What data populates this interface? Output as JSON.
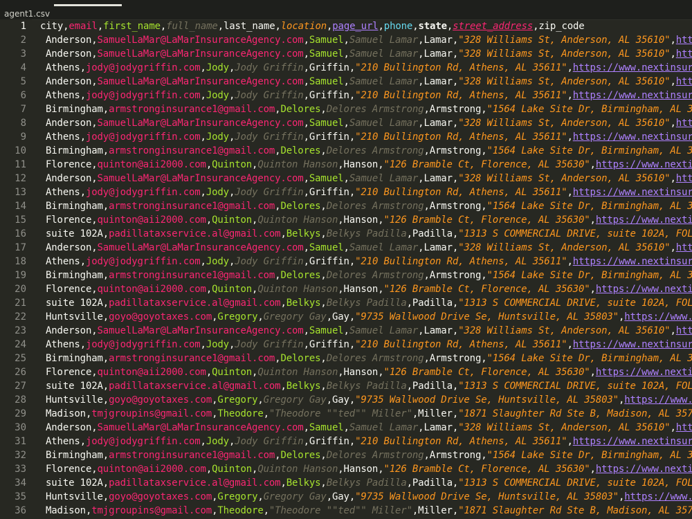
{
  "tab": {
    "title": "agent1.csv"
  },
  "header_line": {
    "number": "1",
    "fields": [
      "city",
      "email",
      "first_name",
      "full_name",
      "last_name",
      "location",
      "page_url",
      "phone",
      "state",
      "street_address",
      "zip_code"
    ],
    "sep": ","
  },
  "rows": [
    {
      "n": "2",
      "city": "Anderson",
      "email": "SamuelLaMar@LaMarInsuranceAgency.com",
      "first": "Samuel",
      "full": "Samuel Lamar",
      "last": "Lamar",
      "loc": "\"328 Williams St, Anderson, AL 35610\"",
      "url": "http"
    },
    {
      "n": "3",
      "city": "Anderson",
      "email": "SamuelLaMar@LaMarInsuranceAgency.com",
      "first": "Samuel",
      "full": "Samuel Lamar",
      "last": "Lamar",
      "loc": "\"328 Williams St, Anderson, AL 35610\"",
      "url": "http"
    },
    {
      "n": "4",
      "city": "Athens",
      "email": "jody@jodygriffin.com",
      "first": "Jody",
      "full": "Jody Griffin",
      "last": "Griffin",
      "loc": "\"210 Bullington Rd, Athens, AL 35611\"",
      "url": "https://www.nextinsur"
    },
    {
      "n": "5",
      "city": "Anderson",
      "email": "SamuelLaMar@LaMarInsuranceAgency.com",
      "first": "Samuel",
      "full": "Samuel Lamar",
      "last": "Lamar",
      "loc": "\"328 Williams St, Anderson, AL 35610\"",
      "url": "http"
    },
    {
      "n": "6",
      "city": "Athens",
      "email": "jody@jodygriffin.com",
      "first": "Jody",
      "full": "Jody Griffin",
      "last": "Griffin",
      "loc": "\"210 Bullington Rd, Athens, AL 35611\"",
      "url": "https://www.nextinsur"
    },
    {
      "n": "7",
      "city": "Birmingham",
      "email": "armstronginsurance1@gmail.com",
      "first": "Delores",
      "full": "Delores Armstrong",
      "last": "Armstrong",
      "loc": "\"1564 Lake Site Dr, Birmingham, AL 35",
      "url": ""
    },
    {
      "n": "8",
      "city": "Anderson",
      "email": "SamuelLaMar@LaMarInsuranceAgency.com",
      "first": "Samuel",
      "full": "Samuel Lamar",
      "last": "Lamar",
      "loc": "\"328 Williams St, Anderson, AL 35610\"",
      "url": "http"
    },
    {
      "n": "9",
      "city": "Athens",
      "email": "jody@jodygriffin.com",
      "first": "Jody",
      "full": "Jody Griffin",
      "last": "Griffin",
      "loc": "\"210 Bullington Rd, Athens, AL 35611\"",
      "url": "https://www.nextinsur"
    },
    {
      "n": "10",
      "city": "Birmingham",
      "email": "armstronginsurance1@gmail.com",
      "first": "Delores",
      "full": "Delores Armstrong",
      "last": "Armstrong",
      "loc": "\"1564 Lake Site Dr, Birmingham, AL 35",
      "url": ""
    },
    {
      "n": "11",
      "city": "Florence",
      "email": "quinton@aii2000.com",
      "first": "Quinton",
      "full": "Quinton Hanson",
      "last": "Hanson",
      "loc": "\"126 Bramble Ct, Florence, AL 35630\"",
      "url": "https://www.nexti"
    },
    {
      "n": "12",
      "city": "Anderson",
      "email": "SamuelLaMar@LaMarInsuranceAgency.com",
      "first": "Samuel",
      "full": "Samuel Lamar",
      "last": "Lamar",
      "loc": "\"328 Williams St, Anderson, AL 35610\"",
      "url": "http"
    },
    {
      "n": "13",
      "city": "Athens",
      "email": "jody@jodygriffin.com",
      "first": "Jody",
      "full": "Jody Griffin",
      "last": "Griffin",
      "loc": "\"210 Bullington Rd, Athens, AL 35611\"",
      "url": "https://www.nextinsur"
    },
    {
      "n": "14",
      "city": "Birmingham",
      "email": "armstronginsurance1@gmail.com",
      "first": "Delores",
      "full": "Delores Armstrong",
      "last": "Armstrong",
      "loc": "\"1564 Lake Site Dr, Birmingham, AL 35",
      "url": ""
    },
    {
      "n": "15",
      "city": "Florence",
      "email": "quinton@aii2000.com",
      "first": "Quinton",
      "full": "Quinton Hanson",
      "last": "Hanson",
      "loc": "\"126 Bramble Ct, Florence, AL 35630\"",
      "url": "https://www.nexti"
    },
    {
      "n": "16",
      "city": "suite 102A",
      "email": "padillataxservice.al@gmail.com",
      "first": "Belkys",
      "full": "Belkys Padilla",
      "last": "Padilla",
      "loc": "\"1313 S COMMERCIAL DRIVE, suite 102A, FOL",
      "url": ""
    },
    {
      "n": "17",
      "city": "Anderson",
      "email": "SamuelLaMar@LaMarInsuranceAgency.com",
      "first": "Samuel",
      "full": "Samuel Lamar",
      "last": "Lamar",
      "loc": "\"328 Williams St, Anderson, AL 35610\"",
      "url": "http"
    },
    {
      "n": "18",
      "city": "Athens",
      "email": "jody@jodygriffin.com",
      "first": "Jody",
      "full": "Jody Griffin",
      "last": "Griffin",
      "loc": "\"210 Bullington Rd, Athens, AL 35611\"",
      "url": "https://www.nextinsur"
    },
    {
      "n": "19",
      "city": "Birmingham",
      "email": "armstronginsurance1@gmail.com",
      "first": "Delores",
      "full": "Delores Armstrong",
      "last": "Armstrong",
      "loc": "\"1564 Lake Site Dr, Birmingham, AL 35",
      "url": ""
    },
    {
      "n": "20",
      "city": "Florence",
      "email": "quinton@aii2000.com",
      "first": "Quinton",
      "full": "Quinton Hanson",
      "last": "Hanson",
      "loc": "\"126 Bramble Ct, Florence, AL 35630\"",
      "url": "https://www.nexti"
    },
    {
      "n": "21",
      "city": "suite 102A",
      "email": "padillataxservice.al@gmail.com",
      "first": "Belkys",
      "full": "Belkys Padilla",
      "last": "Padilla",
      "loc": "\"1313 S COMMERCIAL DRIVE, suite 102A, FOL",
      "url": ""
    },
    {
      "n": "22",
      "city": "Huntsville",
      "email": "goyo@goyotaxes.com",
      "first": "Gregory",
      "full": "Gregory Gay",
      "last": "Gay",
      "loc": "\"9735 Wallwood Drive Se, Huntsville, AL 35803\"",
      "url": "https://www.g"
    },
    {
      "n": "23",
      "city": "Anderson",
      "email": "SamuelLaMar@LaMarInsuranceAgency.com",
      "first": "Samuel",
      "full": "Samuel Lamar",
      "last": "Lamar",
      "loc": "\"328 Williams St, Anderson, AL 35610\"",
      "url": "http"
    },
    {
      "n": "24",
      "city": "Athens",
      "email": "jody@jodygriffin.com",
      "first": "Jody",
      "full": "Jody Griffin",
      "last": "Griffin",
      "loc": "\"210 Bullington Rd, Athens, AL 35611\"",
      "url": "https://www.nextinsur"
    },
    {
      "n": "25",
      "city": "Birmingham",
      "email": "armstronginsurance1@gmail.com",
      "first": "Delores",
      "full": "Delores Armstrong",
      "last": "Armstrong",
      "loc": "\"1564 Lake Site Dr, Birmingham, AL 35",
      "url": ""
    },
    {
      "n": "26",
      "city": "Florence",
      "email": "quinton@aii2000.com",
      "first": "Quinton",
      "full": "Quinton Hanson",
      "last": "Hanson",
      "loc": "\"126 Bramble Ct, Florence, AL 35630\"",
      "url": "https://www.nexti"
    },
    {
      "n": "27",
      "city": "suite 102A",
      "email": "padillataxservice.al@gmail.com",
      "first": "Belkys",
      "full": "Belkys Padilla",
      "last": "Padilla",
      "loc": "\"1313 S COMMERCIAL DRIVE, suite 102A, FOL",
      "url": ""
    },
    {
      "n": "28",
      "city": "Huntsville",
      "email": "goyo@goyotaxes.com",
      "first": "Gregory",
      "full": "Gregory Gay",
      "last": "Gay",
      "loc": "\"9735 Wallwood Drive Se, Huntsville, AL 35803\"",
      "url": "https://www.g"
    },
    {
      "n": "29",
      "city": "Madison",
      "email": "tmjgroupins@gmail.com",
      "first": "Theodore",
      "full": "\"Theodore \"\"ted\"\" Miller\"",
      "last": "Miller",
      "loc": "\"1871 Slaughter Rd Ste B, Madison, AL 357",
      "url": ""
    },
    {
      "n": "30",
      "city": "Anderson",
      "email": "SamuelLaMar@LaMarInsuranceAgency.com",
      "first": "Samuel",
      "full": "Samuel Lamar",
      "last": "Lamar",
      "loc": "\"328 Williams St, Anderson, AL 35610\"",
      "url": "http"
    },
    {
      "n": "31",
      "city": "Athens",
      "email": "jody@jodygriffin.com",
      "first": "Jody",
      "full": "Jody Griffin",
      "last": "Griffin",
      "loc": "\"210 Bullington Rd, Athens, AL 35611\"",
      "url": "https://www.nextinsur"
    },
    {
      "n": "32",
      "city": "Birmingham",
      "email": "armstronginsurance1@gmail.com",
      "first": "Delores",
      "full": "Delores Armstrong",
      "last": "Armstrong",
      "loc": "\"1564 Lake Site Dr, Birmingham, AL 35",
      "url": ""
    },
    {
      "n": "33",
      "city": "Florence",
      "email": "quinton@aii2000.com",
      "first": "Quinton",
      "full": "Quinton Hanson",
      "last": "Hanson",
      "loc": "\"126 Bramble Ct, Florence, AL 35630\"",
      "url": "https://www.nexti"
    },
    {
      "n": "34",
      "city": "suite 102A",
      "email": "padillataxservice.al@gmail.com",
      "first": "Belkys",
      "full": "Belkys Padilla",
      "last": "Padilla",
      "loc": "\"1313 S COMMERCIAL DRIVE, suite 102A, FOL",
      "url": ""
    },
    {
      "n": "35",
      "city": "Huntsville",
      "email": "goyo@goyotaxes.com",
      "first": "Gregory",
      "full": "Gregory Gay",
      "last": "Gay",
      "loc": "\"9735 Wallwood Drive Se, Huntsville, AL 35803\"",
      "url": "https://www.g"
    },
    {
      "n": "36",
      "city": "Madison",
      "email": "tmjgroupins@gmail.com",
      "first": "Theodore",
      "full": "\"Theodore \"\"ted\"\" Miller\"",
      "last": "Miller",
      "loc": "\"1871 Slaughter Rd Ste B, Madison, AL 357",
      "url": ""
    }
  ],
  "colors": {
    "background": "#272822",
    "city": "#f8f8f2",
    "email": "#f92672",
    "first_name": "#a6e22e",
    "full_name": "#75715e",
    "last_name": "#f8f8f2",
    "location": "#fd971f",
    "page_url": "#ae81ff",
    "phone": "#66d9ef",
    "line_number": "#90908a"
  }
}
